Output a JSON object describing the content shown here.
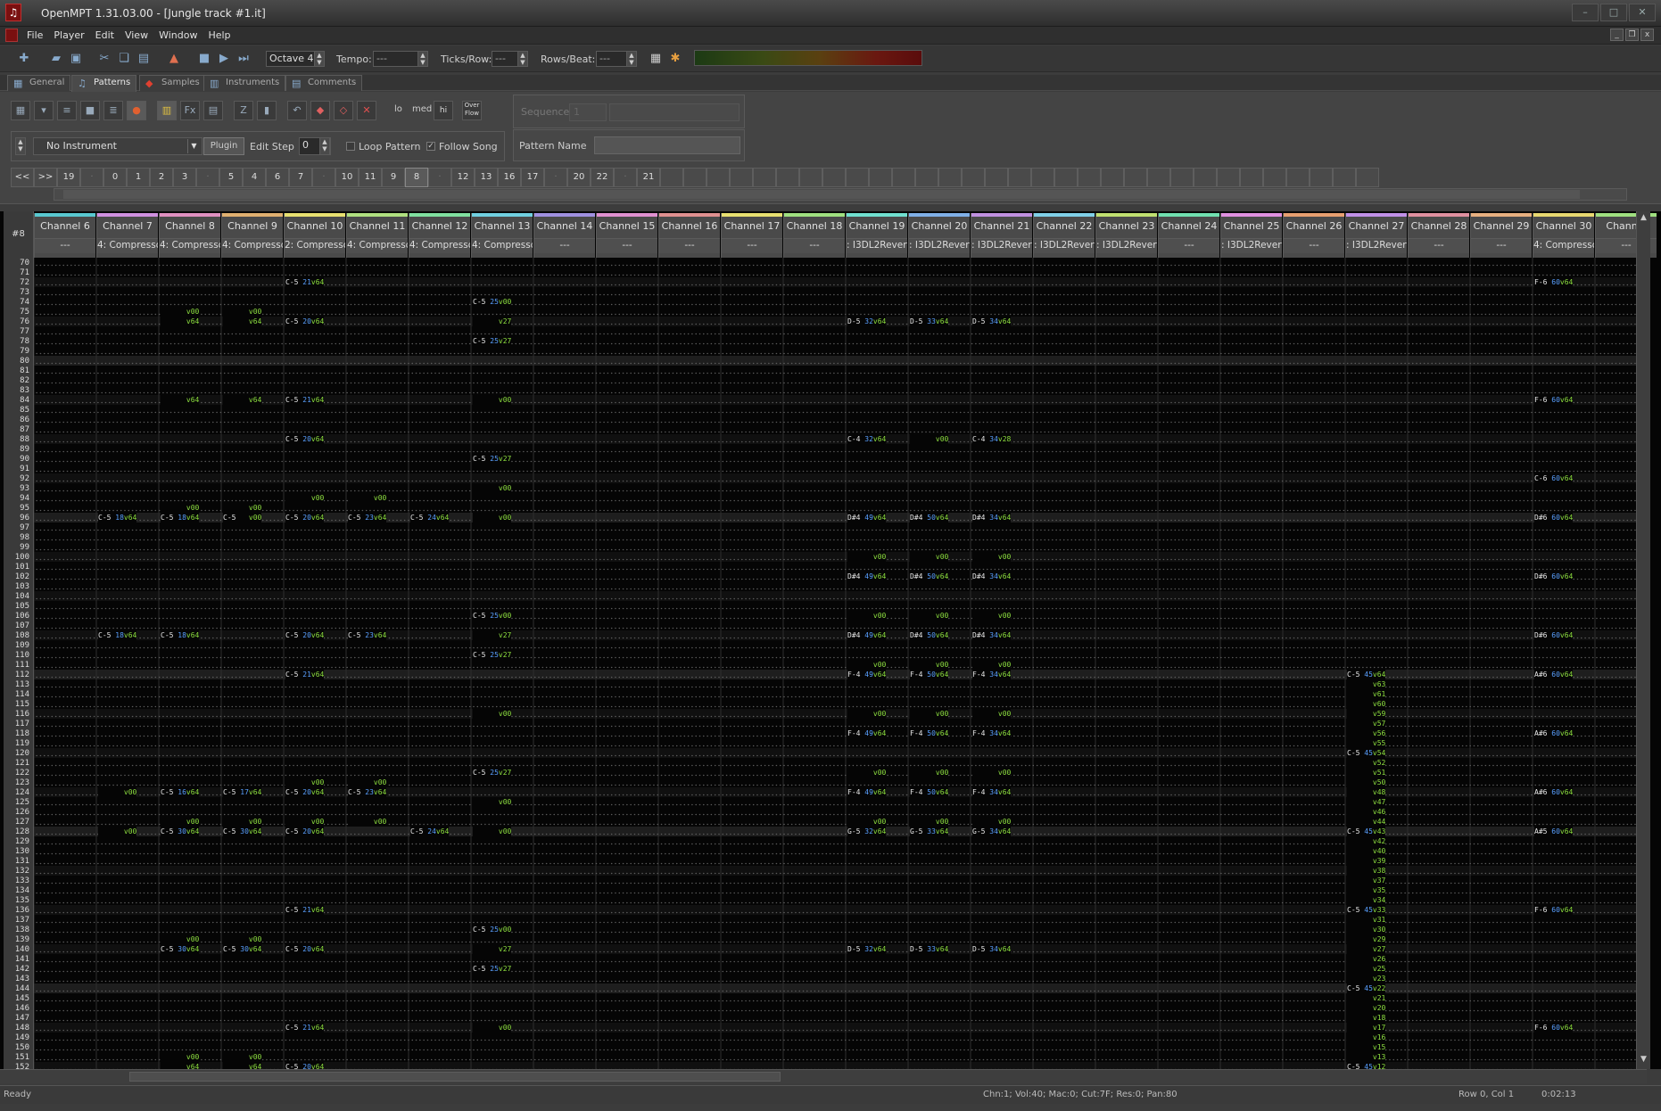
{
  "window": {
    "title": "OpenMPT 1.31.03.00 - [Jungle track #1.it]"
  },
  "menu": [
    "File",
    "Player",
    "Edit",
    "View",
    "Window",
    "Help"
  ],
  "toolbar": {
    "octave": "Octave 4",
    "tempo_label": "Tempo:",
    "tempo_value": "---",
    "ticks_label": "Ticks/Row:",
    "ticks_value": "---",
    "rows_label": "Rows/Beat:",
    "rows_value": "---"
  },
  "tabs": [
    "General",
    "Patterns",
    "Samples",
    "Instruments",
    "Comments"
  ],
  "panel": {
    "lo": "lo",
    "med": "med",
    "hi": "hi",
    "overflow": "Over Flow",
    "sequence_label": "Sequence",
    "sequence_value": "1",
    "instrument": "No Instrument",
    "plugin": "Plugin",
    "edit_step_label": "Edit Step",
    "edit_step_value": "0",
    "loop_pattern": "Loop Pattern",
    "follow_song": "Follow Song",
    "pattern_name_label": "Pattern Name"
  },
  "orders": [
    "<<",
    ">>",
    "19",
    "---",
    "0",
    "1",
    "2",
    "3",
    "---",
    "5",
    "4",
    "6",
    "7",
    "---",
    "10",
    "11",
    "9",
    "8",
    "---",
    "12",
    "13",
    "16",
    "17",
    "---",
    "20",
    "22",
    "---",
    "21"
  ],
  "pattern": {
    "number": "#8",
    "channels": [
      {
        "name": "Channel 6",
        "plugin": "---",
        "color": "#58c8d0"
      },
      {
        "name": "Channel 7",
        "plugin": "4: Compressor",
        "color": "#d090e0"
      },
      {
        "name": "Channel 8",
        "plugin": "4: Compressor",
        "color": "#e090c0"
      },
      {
        "name": "Channel 9",
        "plugin": "4: Compressor",
        "color": "#e0b070"
      },
      {
        "name": "Channel 10",
        "plugin": "2: Compressor",
        "color": "#e8e070"
      },
      {
        "name": "Channel 11",
        "plugin": "4: Compressor",
        "color": "#b0e080"
      },
      {
        "name": "Channel 12",
        "plugin": "4: Compressor",
        "color": "#80e0a0"
      },
      {
        "name": "Channel 13",
        "plugin": "4: Compressor",
        "color": "#70d0e0"
      },
      {
        "name": "Channel 14",
        "plugin": "---",
        "color": "#a090e0"
      },
      {
        "name": "Channel 15",
        "plugin": "---",
        "color": "#e090d0"
      },
      {
        "name": "Channel 16",
        "plugin": "---",
        "color": "#e09090"
      },
      {
        "name": "Channel 17",
        "plugin": "---",
        "color": "#e8e070"
      },
      {
        "name": "Channel 18",
        "plugin": "---",
        "color": "#a0e080"
      },
      {
        "name": "Channel 19",
        "plugin": ": I3DL2Revert",
        "color": "#70e0d0"
      },
      {
        "name": "Channel 20",
        "plugin": ": I3DL2Revert",
        "color": "#80b0e8"
      },
      {
        "name": "Channel 21",
        "plugin": ": I3DL2Revert",
        "color": "#c090e0"
      },
      {
        "name": "Channel 22",
        "plugin": ": I3DL2Revert",
        "color": "#80d0e8"
      },
      {
        "name": "Channel 23",
        "plugin": ": I3DL2Revert",
        "color": "#c0e070"
      },
      {
        "name": "Channel 24",
        "plugin": "---",
        "color": "#70e0b0"
      },
      {
        "name": "Channel 25",
        "plugin": ": I3DL2Revert",
        "color": "#e090e0"
      },
      {
        "name": "Channel 26",
        "plugin": "---",
        "color": "#e8a070"
      },
      {
        "name": "Channel 27",
        "plugin": ": I3DL2Revert",
        "color": "#c090e8"
      },
      {
        "name": "Channel 28",
        "plugin": "---",
        "color": "#e090a0"
      },
      {
        "name": "Channel 29",
        "plugin": "---",
        "color": "#e8b080"
      },
      {
        "name": "Channel 30",
        "plugin": "4: Compressor",
        "color": "#e8d870"
      },
      {
        "name": "Channel",
        "plugin": "---",
        "color": "#a0e080"
      }
    ],
    "first_row": 70,
    "last_row": 152,
    "notes": [
      {
        "row": 72,
        "ch": 4,
        "n": "C-5",
        "i": "21",
        "v": "64"
      },
      {
        "row": 72,
        "ch": 24,
        "n": "F-6",
        "i": "60",
        "v": "64"
      },
      {
        "row": 74,
        "ch": 7,
        "n": "C-5",
        "i": "25",
        "v": "00"
      },
      {
        "row": 75,
        "ch": 2,
        "v": "00"
      },
      {
        "row": 75,
        "ch": 3,
        "v": "00"
      },
      {
        "row": 76,
        "ch": 2,
        "v": "64"
      },
      {
        "row": 76,
        "ch": 3,
        "v": "64"
      },
      {
        "row": 76,
        "ch": 4,
        "n": "C-5",
        "i": "20",
        "v": "64"
      },
      {
        "row": 76,
        "ch": 7,
        "v": "27"
      },
      {
        "row": 76,
        "ch": 13,
        "n": "D-5",
        "i": "32",
        "v": "64"
      },
      {
        "row": 76,
        "ch": 14,
        "n": "D-5",
        "i": "33",
        "v": "64"
      },
      {
        "row": 76,
        "ch": 15,
        "n": "D-5",
        "i": "34",
        "v": "64"
      },
      {
        "row": 78,
        "ch": 7,
        "n": "C-5",
        "i": "25",
        "v": "27"
      },
      {
        "row": 84,
        "ch": 2,
        "v": "64"
      },
      {
        "row": 84,
        "ch": 3,
        "v": "64"
      },
      {
        "row": 84,
        "ch": 4,
        "n": "C-5",
        "i": "21",
        "v": "64"
      },
      {
        "row": 84,
        "ch": 7,
        "v": "00"
      },
      {
        "row": 84,
        "ch": 24,
        "n": "F-6",
        "i": "60",
        "v": "64"
      },
      {
        "row": 88,
        "ch": 4,
        "n": "C-5",
        "i": "20",
        "v": "64"
      },
      {
        "row": 88,
        "ch": 13,
        "n": "C-4",
        "i": "32",
        "v": "64"
      },
      {
        "row": 88,
        "ch": 14,
        "v": "00"
      },
      {
        "row": 88,
        "ch": 15,
        "n": "C-4",
        "i": "34",
        "v": "28"
      },
      {
        "row": 90,
        "ch": 7,
        "n": "C-5",
        "i": "25",
        "v": "27"
      },
      {
        "row": 92,
        "ch": 24,
        "n": "C-6",
        "i": "60",
        "v": "64"
      },
      {
        "row": 93,
        "ch": 7,
        "v": "00"
      },
      {
        "row": 94,
        "ch": 4,
        "v": "00"
      },
      {
        "row": 94,
        "ch": 5,
        "v": "00"
      },
      {
        "row": 95,
        "ch": 2,
        "v": "00"
      },
      {
        "row": 95,
        "ch": 3,
        "v": "00"
      },
      {
        "row": 96,
        "ch": 1,
        "n": "C-5",
        "i": "18",
        "v": "64"
      },
      {
        "row": 96,
        "ch": 2,
        "n": "C-5",
        "i": "18",
        "v": "64"
      },
      {
        "row": 96,
        "ch": 3,
        "n": "C-5",
        "v": "00"
      },
      {
        "row": 96,
        "ch": 4,
        "n": "C-5",
        "i": "20",
        "v": "64"
      },
      {
        "row": 96,
        "ch": 5,
        "n": "C-5",
        "i": "23",
        "v": "64"
      },
      {
        "row": 96,
        "ch": 6,
        "n": "C-5",
        "i": "24",
        "v": "64"
      },
      {
        "row": 96,
        "ch": 7,
        "v": "00"
      },
      {
        "row": 96,
        "ch": 13,
        "n": "D#4",
        "i": "49",
        "v": "64"
      },
      {
        "row": 96,
        "ch": 14,
        "n": "D#4",
        "i": "50",
        "v": "64"
      },
      {
        "row": 96,
        "ch": 15,
        "n": "D#4",
        "i": "34",
        "v": "64"
      },
      {
        "row": 96,
        "ch": 24,
        "n": "D#6",
        "i": "60",
        "v": "64"
      },
      {
        "row": 100,
        "ch": 13,
        "v": "00"
      },
      {
        "row": 100,
        "ch": 14,
        "v": "00"
      },
      {
        "row": 100,
        "ch": 15,
        "v": "00"
      },
      {
        "row": 102,
        "ch": 13,
        "n": "D#4",
        "i": "49",
        "v": "64"
      },
      {
        "row": 102,
        "ch": 14,
        "n": "D#4",
        "i": "50",
        "v": "64"
      },
      {
        "row": 102,
        "ch": 15,
        "n": "D#4",
        "i": "34",
        "v": "64"
      },
      {
        "row": 102,
        "ch": 24,
        "n": "D#6",
        "i": "60",
        "v": "64"
      },
      {
        "row": 106,
        "ch": 7,
        "n": "C-5",
        "i": "25",
        "v": "00"
      },
      {
        "row": 106,
        "ch": 13,
        "v": "00"
      },
      {
        "row": 106,
        "ch": 14,
        "v": "00"
      },
      {
        "row": 106,
        "ch": 15,
        "v": "00"
      },
      {
        "row": 108,
        "ch": 1,
        "n": "C-5",
        "i": "18",
        "v": "64"
      },
      {
        "row": 108,
        "ch": 2,
        "n": "C-5",
        "i": "18",
        "v": "64"
      },
      {
        "row": 108,
        "ch": 4,
        "n": "C-5",
        "i": "20",
        "v": "64"
      },
      {
        "row": 108,
        "ch": 5,
        "n": "C-5",
        "i": "23",
        "v": "64"
      },
      {
        "row": 108,
        "ch": 7,
        "v": "27"
      },
      {
        "row": 108,
        "ch": 13,
        "n": "D#4",
        "i": "49",
        "v": "64"
      },
      {
        "row": 108,
        "ch": 14,
        "n": "D#4",
        "i": "50",
        "v": "64"
      },
      {
        "row": 108,
        "ch": 15,
        "n": "D#4",
        "i": "34",
        "v": "64"
      },
      {
        "row": 108,
        "ch": 24,
        "n": "D#6",
        "i": "60",
        "v": "64"
      },
      {
        "row": 110,
        "ch": 7,
        "n": "C-5",
        "i": "25",
        "v": "27"
      },
      {
        "row": 111,
        "ch": 13,
        "v": "00"
      },
      {
        "row": 111,
        "ch": 14,
        "v": "00"
      },
      {
        "row": 111,
        "ch": 15,
        "v": "00"
      },
      {
        "row": 112,
        "ch": 4,
        "n": "C-5",
        "i": "21",
        "v": "64"
      },
      {
        "row": 112,
        "ch": 13,
        "n": "F-4",
        "i": "49",
        "v": "64"
      },
      {
        "row": 112,
        "ch": 14,
        "n": "F-4",
        "i": "50",
        "v": "64"
      },
      {
        "row": 112,
        "ch": 15,
        "n": "F-4",
        "i": "34",
        "v": "64"
      },
      {
        "row": 112,
        "ch": 21,
        "n": "C-5",
        "i": "45",
        "v": "64"
      },
      {
        "row": 112,
        "ch": 24,
        "n": "A#6",
        "i": "60",
        "v": "64"
      },
      {
        "row": 113,
        "ch": 21,
        "v": "63"
      },
      {
        "row": 114,
        "ch": 21,
        "v": "61"
      },
      {
        "row": 115,
        "ch": 21,
        "v": "60"
      },
      {
        "row": 116,
        "ch": 7,
        "v": "00"
      },
      {
        "row": 116,
        "ch": 13,
        "v": "00"
      },
      {
        "row": 116,
        "ch": 14,
        "v": "00"
      },
      {
        "row": 116,
        "ch": 15,
        "v": "00"
      },
      {
        "row": 116,
        "ch": 21,
        "v": "59"
      },
      {
        "row": 117,
        "ch": 21,
        "v": "57"
      },
      {
        "row": 118,
        "ch": 13,
        "n": "F-4",
        "i": "49",
        "v": "64"
      },
      {
        "row": 118,
        "ch": 14,
        "n": "F-4",
        "i": "50",
        "v": "64"
      },
      {
        "row": 118,
        "ch": 15,
        "n": "F-4",
        "i": "34",
        "v": "64"
      },
      {
        "row": 118,
        "ch": 21,
        "v": "56"
      },
      {
        "row": 118,
        "ch": 24,
        "n": "A#6",
        "i": "60",
        "v": "64"
      },
      {
        "row": 119,
        "ch": 21,
        "v": "55"
      },
      {
        "row": 120,
        "ch": 21,
        "n": "C-5",
        "i": "45",
        "v": "54"
      },
      {
        "row": 121,
        "ch": 21,
        "v": "52"
      },
      {
        "row": 122,
        "ch": 7,
        "n": "C-5",
        "i": "25",
        "v": "27"
      },
      {
        "row": 122,
        "ch": 13,
        "v": "00"
      },
      {
        "row": 122,
        "ch": 14,
        "v": "00"
      },
      {
        "row": 122,
        "ch": 15,
        "v": "00"
      },
      {
        "row": 122,
        "ch": 21,
        "v": "51"
      },
      {
        "row": 123,
        "ch": 4,
        "v": "00"
      },
      {
        "row": 123,
        "ch": 5,
        "v": "00"
      },
      {
        "row": 123,
        "ch": 21,
        "v": "50"
      },
      {
        "row": 124,
        "ch": 1,
        "v": "00"
      },
      {
        "row": 124,
        "ch": 2,
        "n": "C-5",
        "i": "16",
        "v": "64"
      },
      {
        "row": 124,
        "ch": 3,
        "n": "C-5",
        "i": "17",
        "v": "64"
      },
      {
        "row": 124,
        "ch": 4,
        "n": "C-5",
        "i": "20",
        "v": "64"
      },
      {
        "row": 124,
        "ch": 5,
        "n": "C-5",
        "i": "23",
        "v": "64"
      },
      {
        "row": 124,
        "ch": 13,
        "n": "F-4",
        "i": "49",
        "v": "64"
      },
      {
        "row": 124,
        "ch": 14,
        "n": "F-4",
        "i": "50",
        "v": "64"
      },
      {
        "row": 124,
        "ch": 15,
        "n": "F-4",
        "i": "34",
        "v": "64"
      },
      {
        "row": 124,
        "ch": 21,
        "v": "48"
      },
      {
        "row": 124,
        "ch": 24,
        "n": "A#6",
        "i": "60",
        "v": "64"
      },
      {
        "row": 125,
        "ch": 7,
        "v": "00"
      },
      {
        "row": 125,
        "ch": 21,
        "v": "47"
      },
      {
        "row": 126,
        "ch": 21,
        "v": "46"
      },
      {
        "row": 127,
        "ch": 2,
        "v": "00"
      },
      {
        "row": 127,
        "ch": 3,
        "v": "00"
      },
      {
        "row": 127,
        "ch": 4,
        "v": "00"
      },
      {
        "row": 127,
        "ch": 5,
        "v": "00"
      },
      {
        "row": 127,
        "ch": 13,
        "v": "00"
      },
      {
        "row": 127,
        "ch": 14,
        "v": "00"
      },
      {
        "row": 127,
        "ch": 15,
        "v": "00"
      },
      {
        "row": 127,
        "ch": 21,
        "v": "44"
      },
      {
        "row": 128,
        "ch": 1,
        "v": "00"
      },
      {
        "row": 128,
        "ch": 2,
        "n": "C-5",
        "i": "30",
        "v": "64"
      },
      {
        "row": 128,
        "ch": 3,
        "n": "C-5",
        "i": "30",
        "v": "64"
      },
      {
        "row": 128,
        "ch": 4,
        "n": "C-5",
        "i": "20",
        "v": "64"
      },
      {
        "row": 128,
        "ch": 6,
        "n": "C-5",
        "i": "24",
        "v": "64"
      },
      {
        "row": 128,
        "ch": 7,
        "v": "00"
      },
      {
        "row": 128,
        "ch": 13,
        "n": "G-5",
        "i": "32",
        "v": "64"
      },
      {
        "row": 128,
        "ch": 14,
        "n": "G-5",
        "i": "33",
        "v": "64"
      },
      {
        "row": 128,
        "ch": 15,
        "n": "G-5",
        "i": "34",
        "v": "64"
      },
      {
        "row": 128,
        "ch": 21,
        "n": "C-5",
        "i": "45",
        "v": "43"
      },
      {
        "row": 128,
        "ch": 24,
        "n": "A#5",
        "i": "60",
        "v": "64"
      },
      {
        "row": 129,
        "ch": 21,
        "v": "42"
      },
      {
        "row": 130,
        "ch": 21,
        "v": "40"
      },
      {
        "row": 131,
        "ch": 21,
        "v": "39"
      },
      {
        "row": 132,
        "ch": 21,
        "v": "38"
      },
      {
        "row": 133,
        "ch": 21,
        "v": "37"
      },
      {
        "row": 134,
        "ch": 21,
        "v": "35"
      },
      {
        "row": 135,
        "ch": 21,
        "v": "34"
      },
      {
        "row": 136,
        "ch": 4,
        "n": "C-5",
        "i": "21",
        "v": "64"
      },
      {
        "row": 136,
        "ch": 21,
        "n": "C-5",
        "i": "45",
        "v": "33"
      },
      {
        "row": 136,
        "ch": 24,
        "n": "F-6",
        "i": "60",
        "v": "64"
      },
      {
        "row": 137,
        "ch": 21,
        "v": "31"
      },
      {
        "row": 138,
        "ch": 7,
        "n": "C-5",
        "i": "25",
        "v": "00"
      },
      {
        "row": 138,
        "ch": 21,
        "v": "30"
      },
      {
        "row": 139,
        "ch": 2,
        "v": "00"
      },
      {
        "row": 139,
        "ch": 3,
        "v": "00"
      },
      {
        "row": 139,
        "ch": 21,
        "v": "29"
      },
      {
        "row": 140,
        "ch": 2,
        "n": "C-5",
        "i": "30",
        "v": "64"
      },
      {
        "row": 140,
        "ch": 3,
        "n": "C-5",
        "i": "30",
        "v": "64"
      },
      {
        "row": 140,
        "ch": 4,
        "n": "C-5",
        "i": "20",
        "v": "64"
      },
      {
        "row": 140,
        "ch": 7,
        "v": "27"
      },
      {
        "row": 140,
        "ch": 13,
        "n": "D-5",
        "i": "32",
        "v": "64"
      },
      {
        "row": 140,
        "ch": 14,
        "n": "D-5",
        "i": "33",
        "v": "64"
      },
      {
        "row": 140,
        "ch": 15,
        "n": "D-5",
        "i": "34",
        "v": "64"
      },
      {
        "row": 140,
        "ch": 21,
        "v": "27"
      },
      {
        "row": 141,
        "ch": 21,
        "v": "26"
      },
      {
        "row": 142,
        "ch": 7,
        "n": "C-5",
        "i": "25",
        "v": "27"
      },
      {
        "row": 142,
        "ch": 21,
        "v": "25"
      },
      {
        "row": 143,
        "ch": 21,
        "v": "23"
      },
      {
        "row": 144,
        "ch": 21,
        "n": "C-5",
        "i": "45",
        "v": "22"
      },
      {
        "row": 145,
        "ch": 21,
        "v": "21"
      },
      {
        "row": 146,
        "ch": 21,
        "v": "20"
      },
      {
        "row": 147,
        "ch": 21,
        "v": "18"
      },
      {
        "row": 148,
        "ch": 4,
        "n": "C-5",
        "i": "21",
        "v": "64"
      },
      {
        "row": 148,
        "ch": 7,
        "v": "00"
      },
      {
        "row": 148,
        "ch": 21,
        "v": "17"
      },
      {
        "row": 148,
        "ch": 24,
        "n": "F-6",
        "i": "60",
        "v": "64"
      },
      {
        "row": 149,
        "ch": 21,
        "v": "16"
      },
      {
        "row": 150,
        "ch": 21,
        "v": "15"
      },
      {
        "row": 151,
        "ch": 2,
        "v": "00"
      },
      {
        "row": 151,
        "ch": 3,
        "v": "00"
      },
      {
        "row": 151,
        "ch": 21,
        "v": "13"
      },
      {
        "row": 152,
        "ch": 2,
        "v": "64"
      },
      {
        "row": 152,
        "ch": 3,
        "v": "64"
      },
      {
        "row": 152,
        "ch": 4,
        "n": "C-5",
        "i": "20",
        "v": "64"
      },
      {
        "row": 152,
        "ch": 21,
        "n": "C-5",
        "i": "45",
        "v": "12"
      }
    ]
  },
  "status": {
    "left": "Ready",
    "mid": "Chn:1; Vol:40; Mac:0; Cut:7F; Res:0; Pan:80",
    "pos": "Row 0, Col 1",
    "time": "0:02:13"
  }
}
